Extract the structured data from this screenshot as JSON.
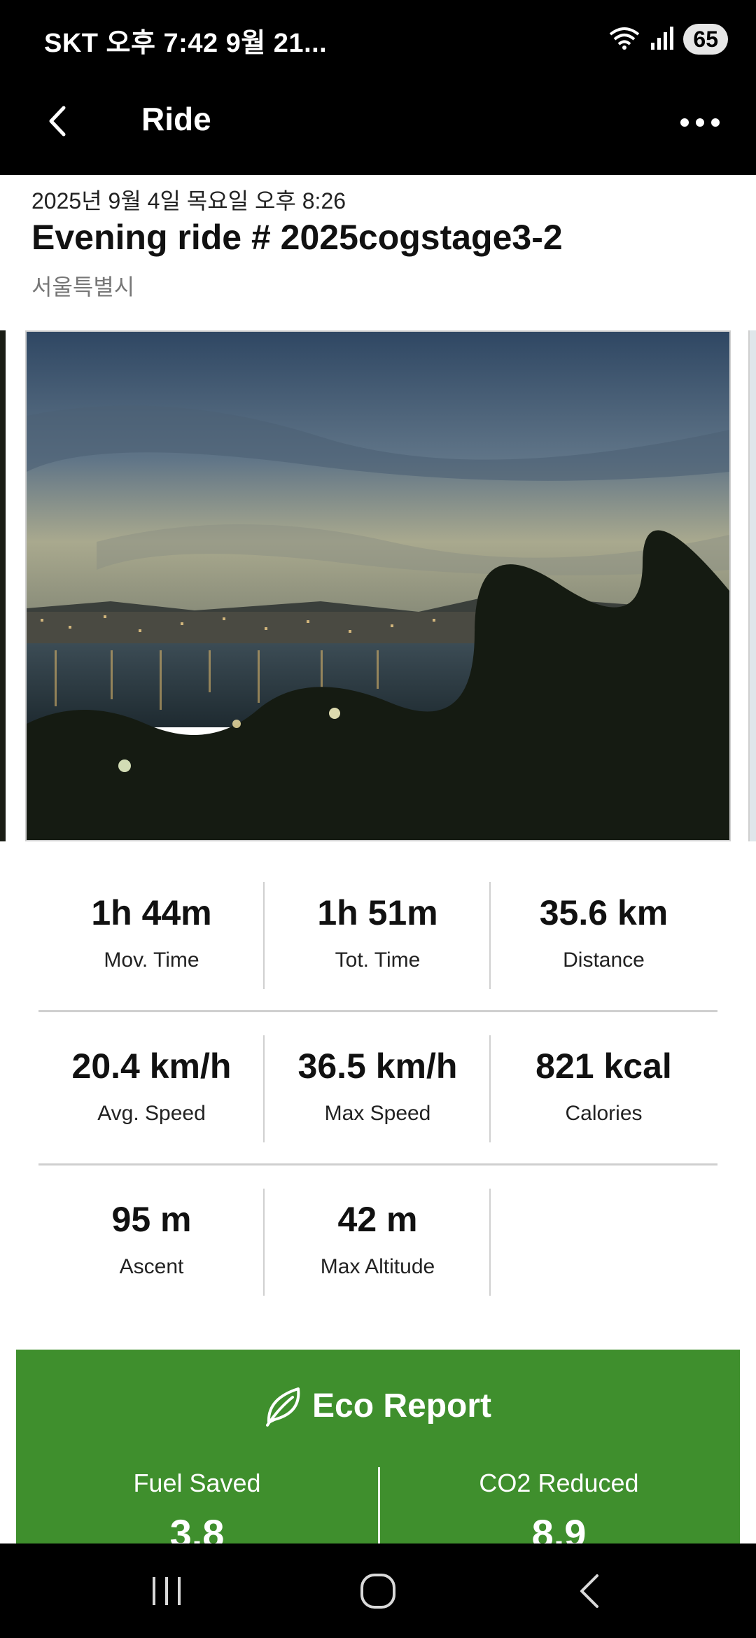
{
  "status_bar": {
    "text": "SKT 오후 7:42  9월 21...",
    "battery": "65"
  },
  "header": {
    "title": "Ride"
  },
  "ride": {
    "date": "2025년 9월 4일 목요일 오후 8:26",
    "title": "Evening ride # 2025cogstage3-2",
    "location": "서울특별시"
  },
  "stats": [
    {
      "value": "1h 44m",
      "label": "Mov. Time"
    },
    {
      "value": "1h 51m",
      "label": "Tot. Time"
    },
    {
      "value": "35.6 km",
      "label": "Distance"
    },
    {
      "value": "20.4 km/h",
      "label": "Avg. Speed"
    },
    {
      "value": "36.5 km/h",
      "label": "Max Speed"
    },
    {
      "value": "821 kcal",
      "label": "Calories"
    },
    {
      "value": "95 m",
      "label": "Ascent"
    },
    {
      "value": "42 m",
      "label": "Max Altitude"
    }
  ],
  "eco_report": {
    "title": "Eco Report",
    "fuel_label": "Fuel Saved",
    "fuel_value": "3.8",
    "co2_label": "CO2 Reduced",
    "co2_value": "8.9"
  },
  "colors": {
    "eco_green": "#3f8f2d",
    "bar_black": "#000000"
  },
  "icons": {
    "back": "chevron-left-icon",
    "more": "more-horizontal-icon",
    "eco": "leaf-icon",
    "wifi": "wifi-icon",
    "signal": "signal-icon",
    "nav_recents": "recents-icon",
    "nav_home": "home-icon",
    "nav_back": "back-icon"
  }
}
